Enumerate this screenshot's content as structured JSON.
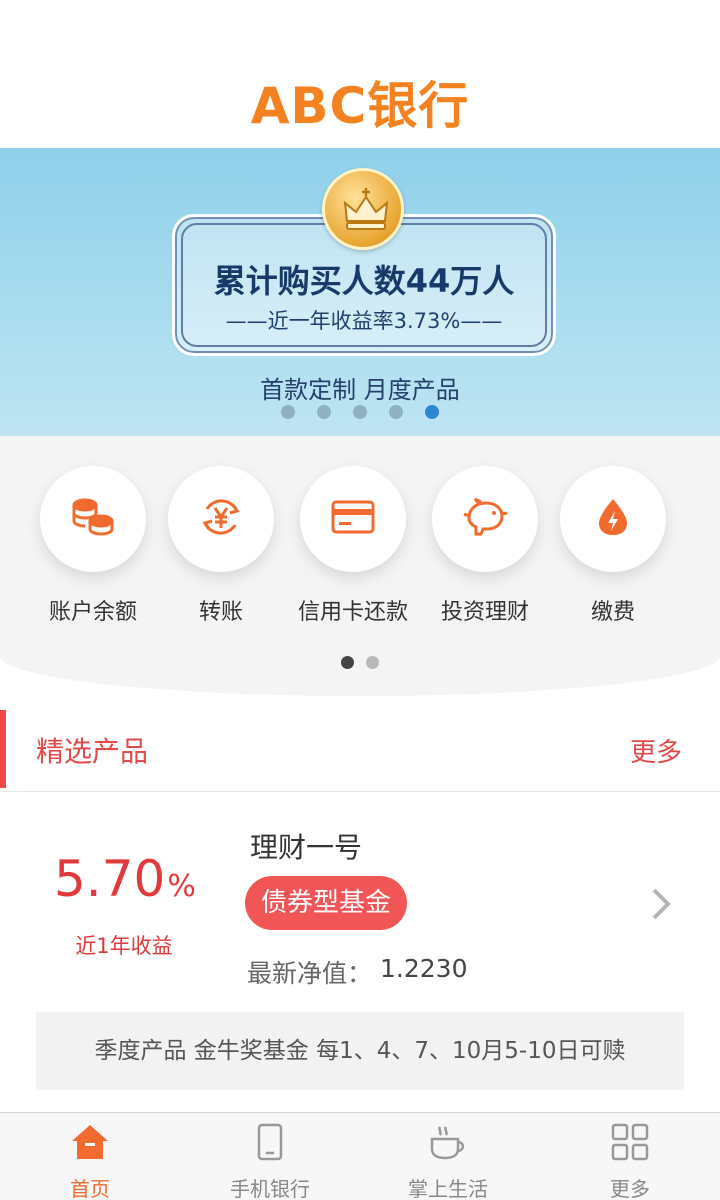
{
  "header": {
    "logo_text": "ABC银行"
  },
  "banner": {
    "headline": "累计购买人数44万人",
    "subline": "近一年收益率3.73%",
    "tagline": "首款定制 月度产品",
    "slide_count": 5,
    "active_slide": 5
  },
  "quick_actions": {
    "items": [
      {
        "label": "账户余额",
        "icon": "coins-icon"
      },
      {
        "label": "转账",
        "icon": "yen-transfer-icon"
      },
      {
        "label": "信用卡还款",
        "icon": "credit-card-icon"
      },
      {
        "label": "投资理财",
        "icon": "piggy-bank-icon"
      },
      {
        "label": "缴费",
        "icon": "bolt-drop-icon"
      }
    ],
    "page_count": 2,
    "active_page": 1
  },
  "featured": {
    "title": "精选产品",
    "more_label": "更多",
    "product": {
      "rate_value": "5.70",
      "rate_unit": "%",
      "rate_label": "近1年收益",
      "name": "理财一号",
      "tag": "债券型基金",
      "nav_label": "最新净值：",
      "nav_value": "1.2230",
      "note": "季度产品 金牛奖基金 每1、4、7、10月5-10日可赎"
    }
  },
  "tabbar": {
    "items": [
      {
        "label": "首页",
        "icon": "home-icon",
        "active": true
      },
      {
        "label": "手机银行",
        "icon": "phone-icon",
        "active": false
      },
      {
        "label": "掌上生活",
        "icon": "coffee-cup-icon",
        "active": false
      },
      {
        "label": "更多",
        "icon": "grid-icon",
        "active": false
      }
    ]
  },
  "colors": {
    "brand": "#f58220",
    "accent_red": "#e23a3a",
    "tab_active": "#f26b2e",
    "dot_active": "#2d86d6"
  }
}
